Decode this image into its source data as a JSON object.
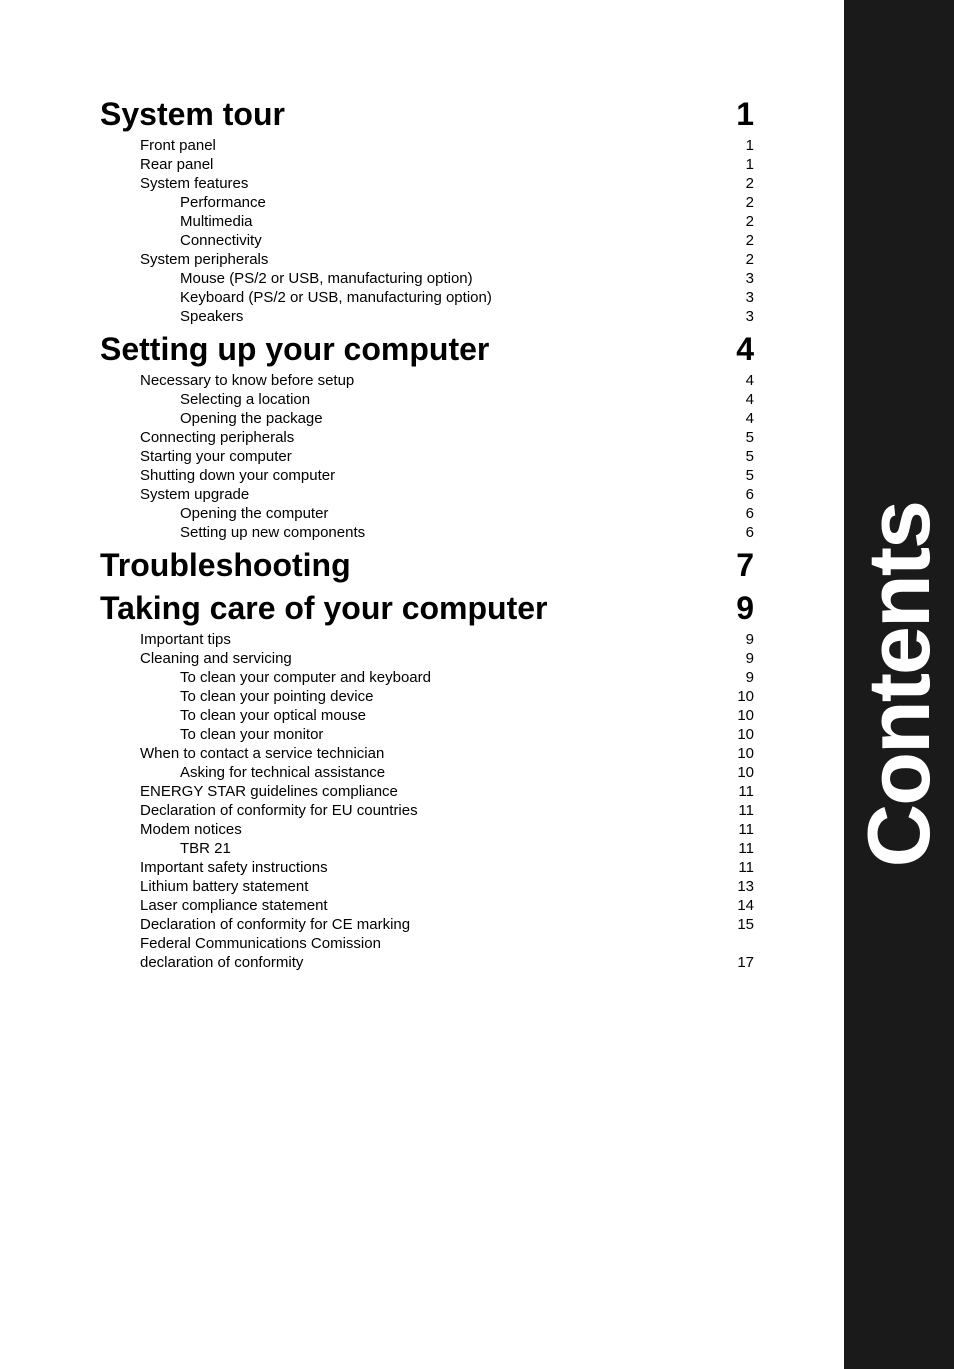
{
  "sidebar": {
    "text": "Contents"
  },
  "sections": [
    {
      "title": "System tour",
      "page": "1",
      "items": [
        {
          "label": "Front panel",
          "page": "1",
          "indent": 1
        },
        {
          "label": "Rear panel",
          "page": "1",
          "indent": 1
        },
        {
          "label": "System features",
          "page": "2",
          "indent": 1
        },
        {
          "label": "Performance",
          "page": "2",
          "indent": 2
        },
        {
          "label": "Multimedia",
          "page": "2",
          "indent": 2
        },
        {
          "label": "Connectivity",
          "page": "2",
          "indent": 2
        },
        {
          "label": "System peripherals",
          "page": "2",
          "indent": 1
        },
        {
          "label": "Mouse (PS/2 or USB, manufacturing option)",
          "page": "3",
          "indent": 2
        },
        {
          "label": "Keyboard (PS/2 or USB, manufacturing option)",
          "page": "3",
          "indent": 2
        },
        {
          "label": "Speakers",
          "page": "3",
          "indent": 2
        }
      ]
    },
    {
      "title": "Setting up your computer",
      "page": "4",
      "items": [
        {
          "label": "Necessary to know before setup",
          "page": "4",
          "indent": 1
        },
        {
          "label": "Selecting a location",
          "page": "4",
          "indent": 2
        },
        {
          "label": "Opening the package",
          "page": "4",
          "indent": 2
        },
        {
          "label": "Connecting peripherals",
          "page": "5",
          "indent": 1
        },
        {
          "label": "Starting your computer",
          "page": "5",
          "indent": 1
        },
        {
          "label": "Shutting down your computer",
          "page": "5",
          "indent": 1
        },
        {
          "label": "System upgrade",
          "page": "6",
          "indent": 1
        },
        {
          "label": "Opening the computer",
          "page": "6",
          "indent": 2
        },
        {
          "label": "Setting up new components",
          "page": "6",
          "indent": 2
        }
      ]
    },
    {
      "title": "Troubleshooting",
      "page": "7",
      "items": []
    },
    {
      "title": "Taking care of your computer",
      "page": "9",
      "items": [
        {
          "label": "Important tips",
          "page": "9",
          "indent": 1
        },
        {
          "label": "Cleaning and servicing",
          "page": "9",
          "indent": 1
        },
        {
          "label": "To clean your computer and keyboard",
          "page": "9",
          "indent": 2
        },
        {
          "label": "To clean your pointing device",
          "page": "10",
          "indent": 2
        },
        {
          "label": "To clean your optical mouse",
          "page": "10",
          "indent": 2
        },
        {
          "label": "To clean your monitor",
          "page": "10",
          "indent": 2
        },
        {
          "label": "When to contact a service technician",
          "page": "10",
          "indent": 1
        },
        {
          "label": "Asking for technical assistance",
          "page": "10",
          "indent": 2
        },
        {
          "label": "ENERGY STAR guidelines compliance",
          "page": "11",
          "indent": 1
        },
        {
          "label": "Declaration of conformity for EU countries",
          "page": "11",
          "indent": 1
        },
        {
          "label": "Modem notices",
          "page": "11",
          "indent": 1
        },
        {
          "label": "TBR 21",
          "page": "11",
          "indent": 2
        },
        {
          "label": "Important safety instructions",
          "page": "11",
          "indent": 1
        },
        {
          "label": "Lithium battery statement",
          "page": "13",
          "indent": 1
        },
        {
          "label": "Laser compliance statement",
          "page": "14",
          "indent": 1
        },
        {
          "label": "Declaration of conformity for CE marking",
          "page": "15",
          "indent": 1
        },
        {
          "label": "Federal Communications Comission",
          "page": "",
          "indent": 1
        },
        {
          "label": "declaration of conformity",
          "page": "17",
          "indent": 1
        }
      ]
    }
  ]
}
